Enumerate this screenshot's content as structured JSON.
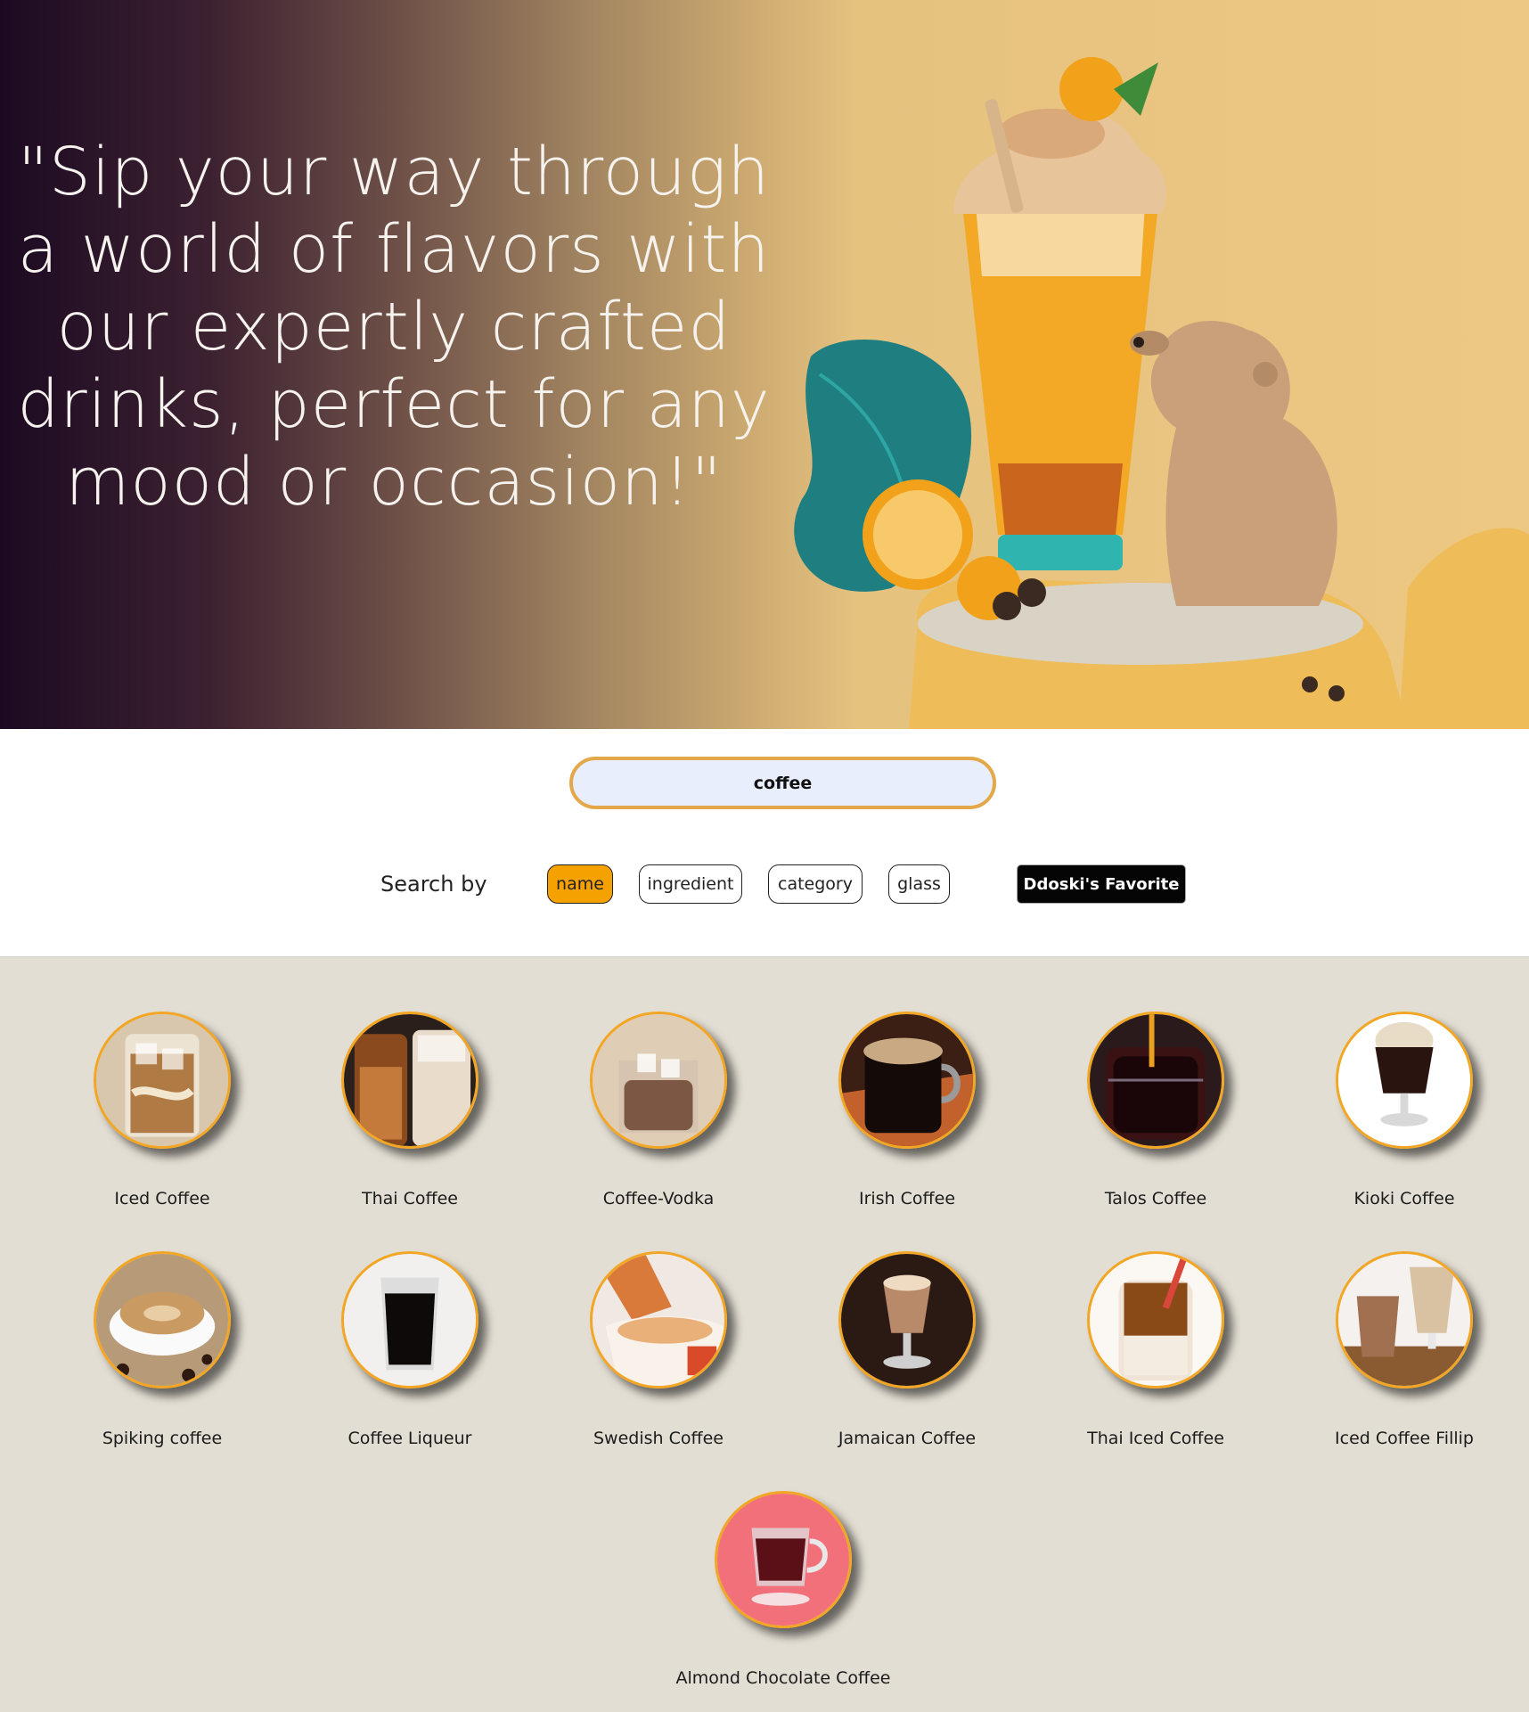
{
  "hero": {
    "quote": "\"Sip your way through a world of flavors with our expertly crafted drinks, perfect for any mood or occasion!\""
  },
  "search": {
    "value": "coffee",
    "placeholder": ""
  },
  "filters": {
    "label": "Search by",
    "options": [
      {
        "label": "name",
        "active": true
      },
      {
        "label": "ingredient",
        "active": false
      },
      {
        "label": "category",
        "active": false
      },
      {
        "label": "glass",
        "active": false
      }
    ],
    "favorite_label": "Ddoski's Favorite"
  },
  "colors": {
    "accent": "#f5a100",
    "ring": "#f2a623",
    "results_bg": "#e3ded3",
    "search_border": "#e2a84a"
  },
  "drinks": [
    {
      "name": "Iced Coffee",
      "icon": "iced-coffee-glass-icon"
    },
    {
      "name": "Thai Coffee",
      "icon": "thai-coffee-glasses-icon"
    },
    {
      "name": "Coffee-Vodka",
      "icon": "coffee-vodka-glass-icon"
    },
    {
      "name": "Irish Coffee",
      "icon": "irish-coffee-mug-icon"
    },
    {
      "name": "Talos Coffee",
      "icon": "talos-coffee-glass-icon"
    },
    {
      "name": "Kioki Coffee",
      "icon": "kioki-coffee-glass-icon"
    },
    {
      "name": "Spiking coffee",
      "icon": "spiking-coffee-cup-icon"
    },
    {
      "name": "Coffee Liqueur",
      "icon": "coffee-liqueur-glass-icon"
    },
    {
      "name": "Swedish Coffee",
      "icon": "swedish-coffee-pour-icon"
    },
    {
      "name": "Jamaican Coffee",
      "icon": "jamaican-coffee-glass-icon"
    },
    {
      "name": "Thai Iced Coffee",
      "icon": "thai-iced-coffee-jar-icon"
    },
    {
      "name": "Iced Coffee Fillip",
      "icon": "iced-coffee-fillip-glasses-icon"
    },
    {
      "name": "Almond Chocolate Coffee",
      "icon": "almond-chocolate-coffee-mug-icon"
    }
  ]
}
